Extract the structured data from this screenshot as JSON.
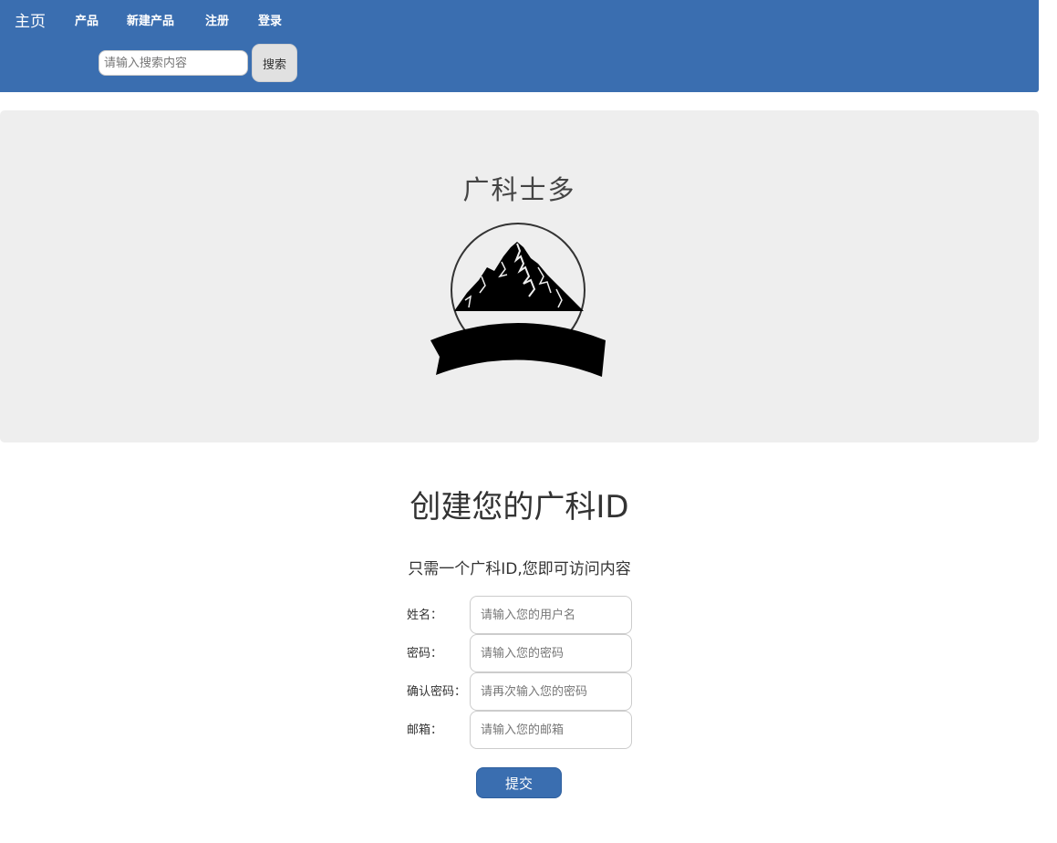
{
  "navbar": {
    "brand": "主页",
    "items": [
      {
        "label": "产品"
      },
      {
        "label": "新建产品"
      },
      {
        "label": "注册"
      },
      {
        "label": "登录"
      }
    ],
    "search": {
      "placeholder": "请输入搜索内容",
      "value": "",
      "button_label": "搜索"
    }
  },
  "jumbotron": {
    "title": "广科士多",
    "logo_icon": "mountain-logo-icon"
  },
  "registration": {
    "title": "创建您的广科ID",
    "subtitle": "只需一个广科ID,您即可访问内容",
    "fields": [
      {
        "label": "姓名：",
        "placeholder": "请输入您的用户名",
        "value": ""
      },
      {
        "label": "密码：",
        "placeholder": "请输入您的密码",
        "value": ""
      },
      {
        "label": "确认密码：",
        "placeholder": "请再次输入您的密码",
        "value": ""
      },
      {
        "label": "邮箱：",
        "placeholder": "请输入您的邮箱",
        "value": ""
      }
    ],
    "submit_label": "提交"
  },
  "colors": {
    "navbar_bg": "#3a6eb0",
    "jumbotron_bg": "#eeeeee",
    "submit_bg": "#3a6eb0"
  }
}
